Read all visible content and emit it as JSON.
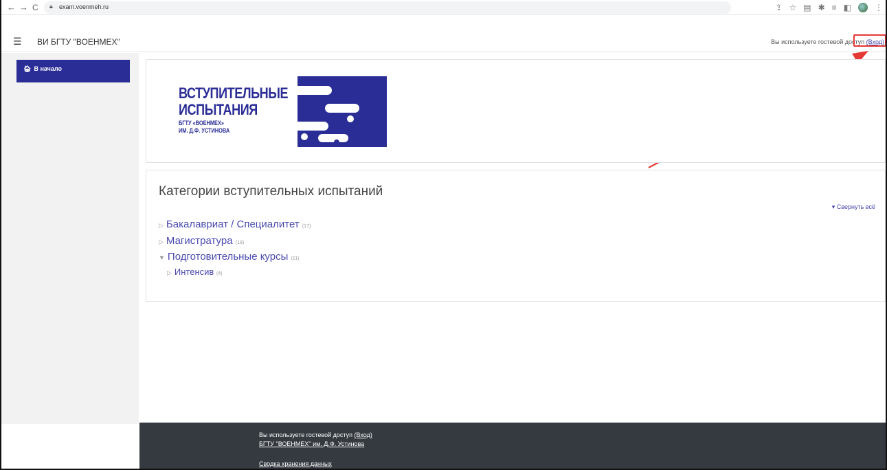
{
  "browser": {
    "url": "exam.voenmeh.ru",
    "back_glyph": "←",
    "forward_glyph": "→",
    "reload_glyph": "C"
  },
  "navbar": {
    "site_name": "ВИ БГТУ \"ВОЕНМЕХ\"",
    "guest_text": "Вы используете гостевой доступ",
    "login_label": "(Вход)"
  },
  "sidebar": {
    "home_label": "В начало"
  },
  "banner": {
    "line1": "ВСТУПИТЕЛЬНЫЕ",
    "line2": "ИСПЫТАНИЯ",
    "sub1": "БГТУ «ВОЕНМЕХ»",
    "sub2": "ИМ. Д.Ф. УСТИНОВА",
    "brand_color": "#2b2d96"
  },
  "categories": {
    "title": "Категории вступительных испытаний",
    "collapse_all": "Свернуть всё",
    "items": [
      {
        "label": "Бакалавриат / Специалитет",
        "count": "(17)"
      },
      {
        "label": "Магистратура",
        "count": "(18)"
      },
      {
        "label": "Подготовительные курсы",
        "count": "(11)"
      },
      {
        "label": "Интенсив",
        "count": "(4)"
      }
    ]
  },
  "footer": {
    "guest_text": "Вы используете гостевой доступ",
    "login_label": "(Вход)",
    "org_link": "БГТУ \"ВОЕНМЕХ\" им. Д.Ф. Устинова",
    "data_retention": "Сводка хранения данных"
  }
}
